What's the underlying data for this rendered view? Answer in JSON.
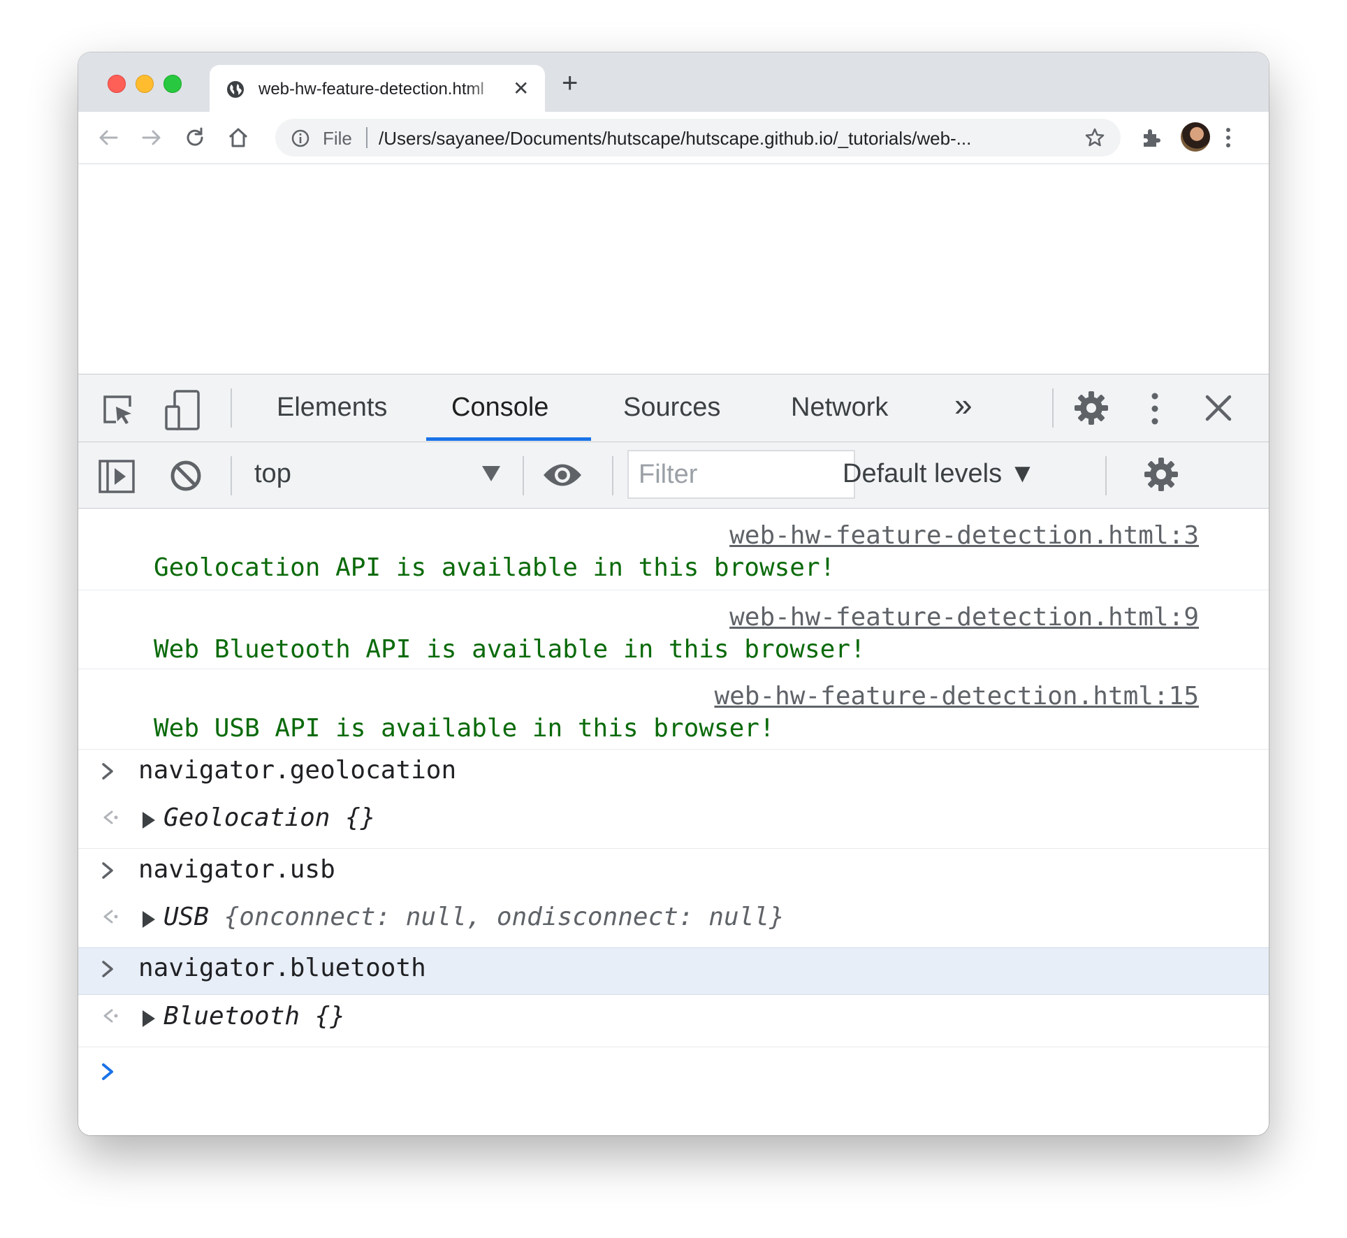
{
  "browser": {
    "tab_title": "web-hw-feature-detection.html",
    "tab_close": "✕",
    "new_tab": "+",
    "omnibox": {
      "scheme_label": "File",
      "url": "/Users/sayanee/Documents/hutscape/hutscape.github.io/_tutorials/web-..."
    }
  },
  "devtools": {
    "tabs": [
      {
        "label": "Elements"
      },
      {
        "label": "Console"
      },
      {
        "label": "Sources"
      },
      {
        "label": "Network"
      }
    ],
    "more_tabs": "»",
    "console_toolbar": {
      "context": "top",
      "filter_placeholder": "Filter",
      "levels": "Default levels ▼"
    }
  },
  "console": {
    "log_messages": [
      {
        "source": "web-hw-feature-detection.html:3",
        "text": "Geolocation API is available in this browser!"
      },
      {
        "source": "web-hw-feature-detection.html:9",
        "text": "Web Bluetooth API is available in this browser!"
      },
      {
        "source": "web-hw-feature-detection.html:15",
        "text": "Web USB API is available in this browser!"
      }
    ],
    "evaluations": [
      {
        "input": "navigator.geolocation",
        "result_name": "Geolocation",
        "result_body": " {}"
      },
      {
        "input": "navigator.usb",
        "result_name": "USB",
        "result_body": " {onconnect: null, ondisconnect: null}"
      },
      {
        "input": "navigator.bluetooth",
        "result_name": "Bluetooth",
        "result_body": " {}"
      }
    ]
  },
  "colors": {
    "accent": "#1a73e8",
    "log_green": "#0a6a0a",
    "prompt_blue": "#1a73e8"
  }
}
